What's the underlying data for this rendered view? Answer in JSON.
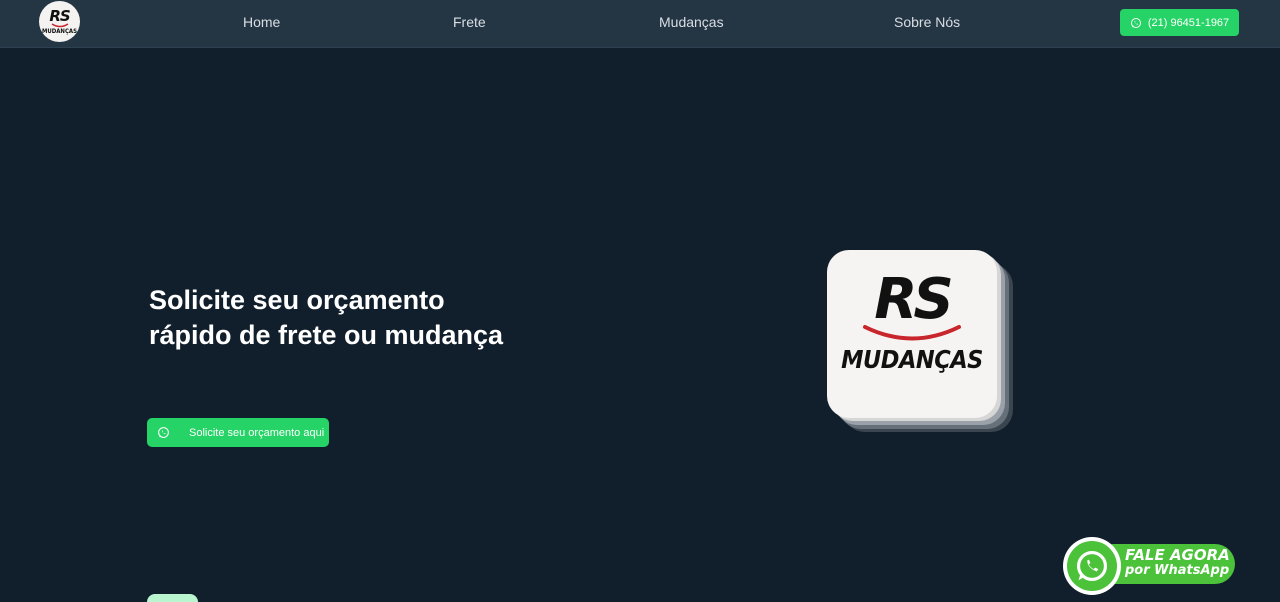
{
  "header": {
    "logo": {
      "rs": "RS",
      "name": "MUDANÇAS"
    },
    "nav": [
      "Home",
      "Frete",
      "Mudanças",
      "Sobre Nós"
    ],
    "phone_label": "(21) 96451-1967"
  },
  "hero": {
    "title": "Solicite seu orçamento rápido de frete ou mudança",
    "cta_label": "Solicite seu orçamento aqui"
  },
  "brand_logo": {
    "rs": "RS",
    "name": "MUDANÇAS"
  },
  "whatsapp_float": {
    "line1": "FALE AGORA",
    "line2": "por WhatsApp"
  },
  "colors": {
    "background": "#111f2c",
    "header": "#243544",
    "whatsapp_green": "#25d366",
    "float_green": "#4bc23a",
    "smile_red": "#c8252c"
  },
  "icons": [
    "whatsapp-icon"
  ]
}
